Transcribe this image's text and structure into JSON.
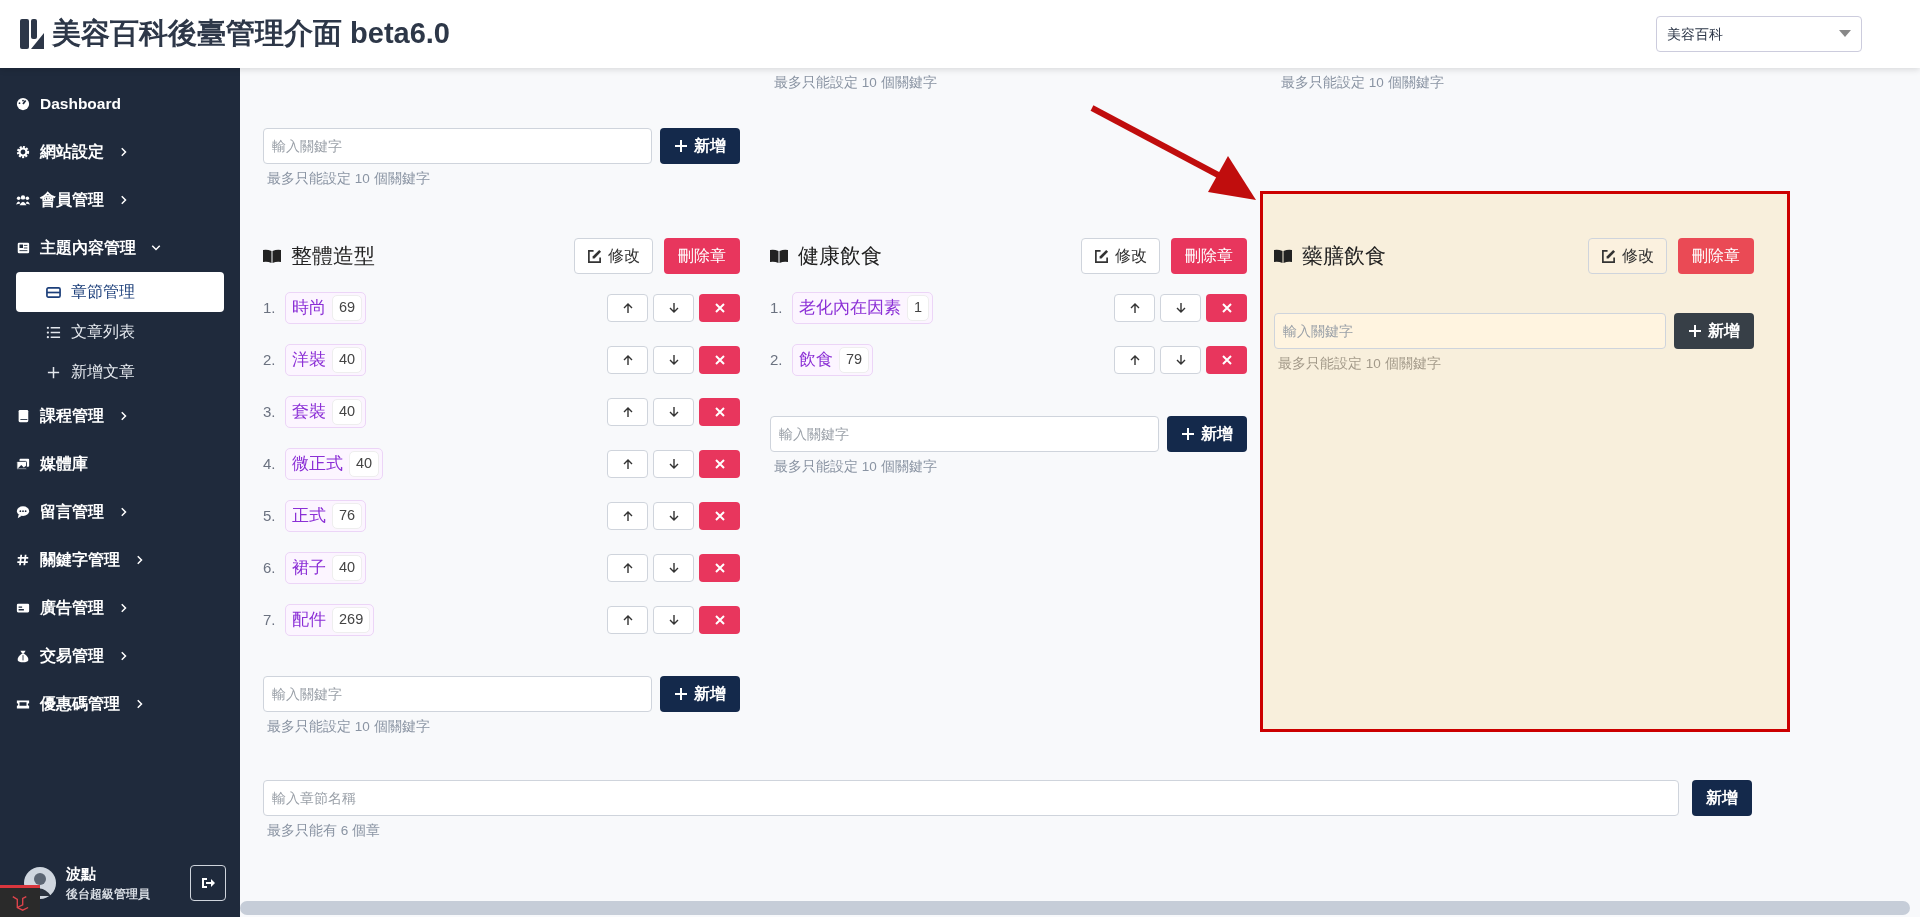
{
  "header": {
    "title": "美容百科後臺管理介面 beta6.0",
    "site_select": "美容百科"
  },
  "sidebar": {
    "items": [
      {
        "label": "Dashboard"
      },
      {
        "label": "網站設定",
        "expanded": false
      },
      {
        "label": "會員管理",
        "expanded": false
      },
      {
        "label": "主題內容管理",
        "expanded": true,
        "children": [
          {
            "label": "章節管理",
            "selected": true
          },
          {
            "label": "文章列表",
            "selected": false
          },
          {
            "label": "新增文章",
            "selected": false
          }
        ]
      },
      {
        "label": "課程管理",
        "expanded": false
      },
      {
        "label": "媒體庫"
      },
      {
        "label": "留言管理",
        "expanded": false
      },
      {
        "label": "關鍵字管理",
        "expanded": false
      },
      {
        "label": "廣告管理",
        "expanded": false
      },
      {
        "label": "交易管理",
        "expanded": false
      },
      {
        "label": "優惠碼管理",
        "expanded": false
      }
    ],
    "user": {
      "name": "波點",
      "role": "後台超級管理員"
    }
  },
  "top_row_partial": [
    {
      "keyword_input": {
        "placeholder": "輸入關鍵字"
      },
      "add_button": "新增",
      "hint": "最多只能設定 10 個關鍵字"
    },
    {
      "hint": "最多只能設定 10 個關鍵字"
    },
    {
      "hint": "最多只能設定 10 個關鍵字"
    }
  ],
  "chapters": [
    {
      "title": "整體造型",
      "highlighted": false,
      "edit_button": "修改",
      "delete_button": "刪除章",
      "keywords": [
        {
          "number": "1.",
          "name": "時尚",
          "count": "69"
        },
        {
          "number": "2.",
          "name": "洋裝",
          "count": "40"
        },
        {
          "number": "3.",
          "name": "套裝",
          "count": "40"
        },
        {
          "number": "4.",
          "name": "微正式",
          "count": "40"
        },
        {
          "number": "5.",
          "name": "正式",
          "count": "76"
        },
        {
          "number": "6.",
          "name": "裙子",
          "count": "40"
        },
        {
          "number": "7.",
          "name": "配件",
          "count": "269"
        }
      ],
      "keyword_input": {
        "placeholder": "輸入關鍵字"
      },
      "add_button": "新增",
      "hint": "最多只能設定 10 個關鍵字"
    },
    {
      "title": "健康飲食",
      "highlighted": false,
      "edit_button": "修改",
      "delete_button": "刪除章",
      "keywords": [
        {
          "number": "1.",
          "name": "老化內在因素",
          "count": "1"
        },
        {
          "number": "2.",
          "name": "飲食",
          "count": "79"
        }
      ],
      "keyword_input": {
        "placeholder": "輸入關鍵字"
      },
      "add_button": "新增",
      "hint": "最多只能設定 10 個關鍵字"
    },
    {
      "title": "藥膳飲食",
      "highlighted": true,
      "edit_button": "修改",
      "delete_button": "刪除章",
      "keyword_input": {
        "placeholder": "輸入關鍵字"
      },
      "add_button": "新增",
      "hint": "最多只能設定 10 個關鍵字"
    }
  ],
  "new_chapter": {
    "input": {
      "placeholder": "輸入章節名稱"
    },
    "add_button": "新增",
    "hint": "最多只能有 6 個章"
  }
}
